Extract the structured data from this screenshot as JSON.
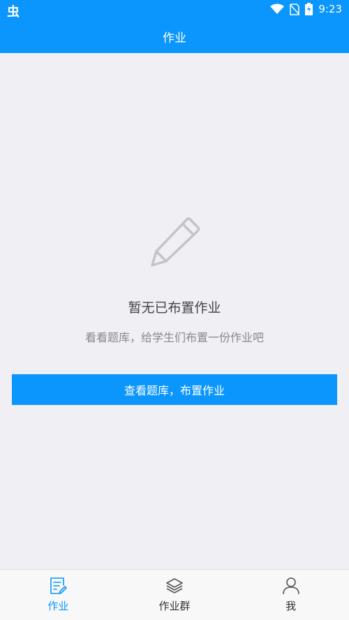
{
  "status_bar": {
    "app_glyph": "虫",
    "time": "9:23",
    "icons": [
      "wifi-icon",
      "no-sim-icon",
      "battery-charging-icon"
    ]
  },
  "nav": {
    "title": "作业"
  },
  "empty_state": {
    "icon": "pencil-icon",
    "title": "暂无已布置作业",
    "subtitle": "看看题库，给学生们布置一份作业吧",
    "button_label": "查看题库，布置作业"
  },
  "tabs": [
    {
      "label": "作业",
      "icon": "homework-icon",
      "active": true
    },
    {
      "label": "作业群",
      "icon": "layers-icon",
      "active": false
    },
    {
      "label": "我",
      "icon": "person-icon",
      "active": false
    }
  ],
  "colors": {
    "primary": "#0a96fc",
    "background": "#efeff4",
    "tab_bar": "#f8f8f8"
  }
}
